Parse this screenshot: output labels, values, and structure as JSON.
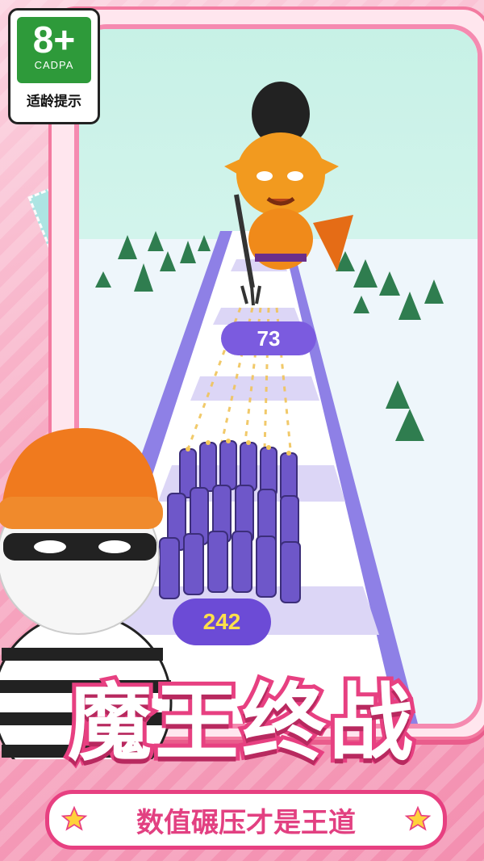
{
  "rating_badge": {
    "age": "8+",
    "org": "CADPA",
    "tip": "适龄提示"
  },
  "game": {
    "boss_count": "73",
    "crowd_count": "242"
  },
  "banner": {
    "title": "魔王终战",
    "slogan": "数值碾压才是王道"
  },
  "icons": [
    "star-icon",
    "tree-icon",
    "boss-character-icon",
    "thief-character-icon",
    "gun-soldier-icon"
  ],
  "colors": {
    "brand_pink": "#e74081",
    "badge_green": "#2e9a3a",
    "count_bubble": "#6c4bd6",
    "count_text": "#ffe04a",
    "track_purple": "#8e80e6"
  }
}
